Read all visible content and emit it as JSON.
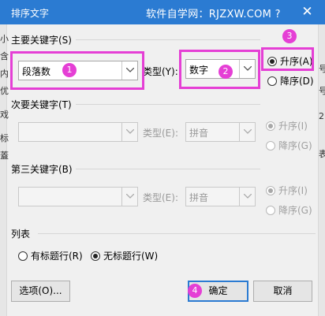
{
  "window": {
    "title": "排序文字",
    "watermark": "软件自学网：RJZXW.COM ?",
    "close_glyph": "✕"
  },
  "background_fragments": {
    "left": [
      "小",
      "含",
      "内",
      "优",
      "戏",
      "标",
      "蓋"
    ],
    "right": [
      "号",
      "号",
      "2",
      "表"
    ]
  },
  "primary_key": {
    "label": "主要关键字(S)",
    "value": "段落数",
    "type_label": "类型(Y):",
    "type_value": "数字",
    "ascending": "升序(A)",
    "descending": "降序(D)",
    "selected": "ascending"
  },
  "secondary_key": {
    "label": "次要关键字(T)",
    "value": "",
    "type_label": "类型(E):",
    "type_value": "拼音",
    "ascending": "升序(I)",
    "descending": "降序(G)",
    "selected": "ascending"
  },
  "tertiary_key": {
    "label": "第三关键字(B)",
    "value": "",
    "type_label": "类型(E):",
    "type_value": "拼音",
    "ascending": "升序(I)",
    "descending": "降序(G)",
    "selected": "ascending"
  },
  "list": {
    "label": "列表",
    "has_header": "有标题行(R)",
    "no_header": "无标题行(W)",
    "selected": "no_header"
  },
  "buttons": {
    "options": "选项(O)...",
    "ok": "确定",
    "cancel": "取消"
  },
  "annotations": {
    "marker_1": "1",
    "marker_2": "2",
    "marker_3": "3",
    "marker_4": "4",
    "highlight_color": "#e53fd5"
  },
  "colors": {
    "titlebar": "#2b7bd2",
    "default_button_border": "#2b7bd2"
  }
}
